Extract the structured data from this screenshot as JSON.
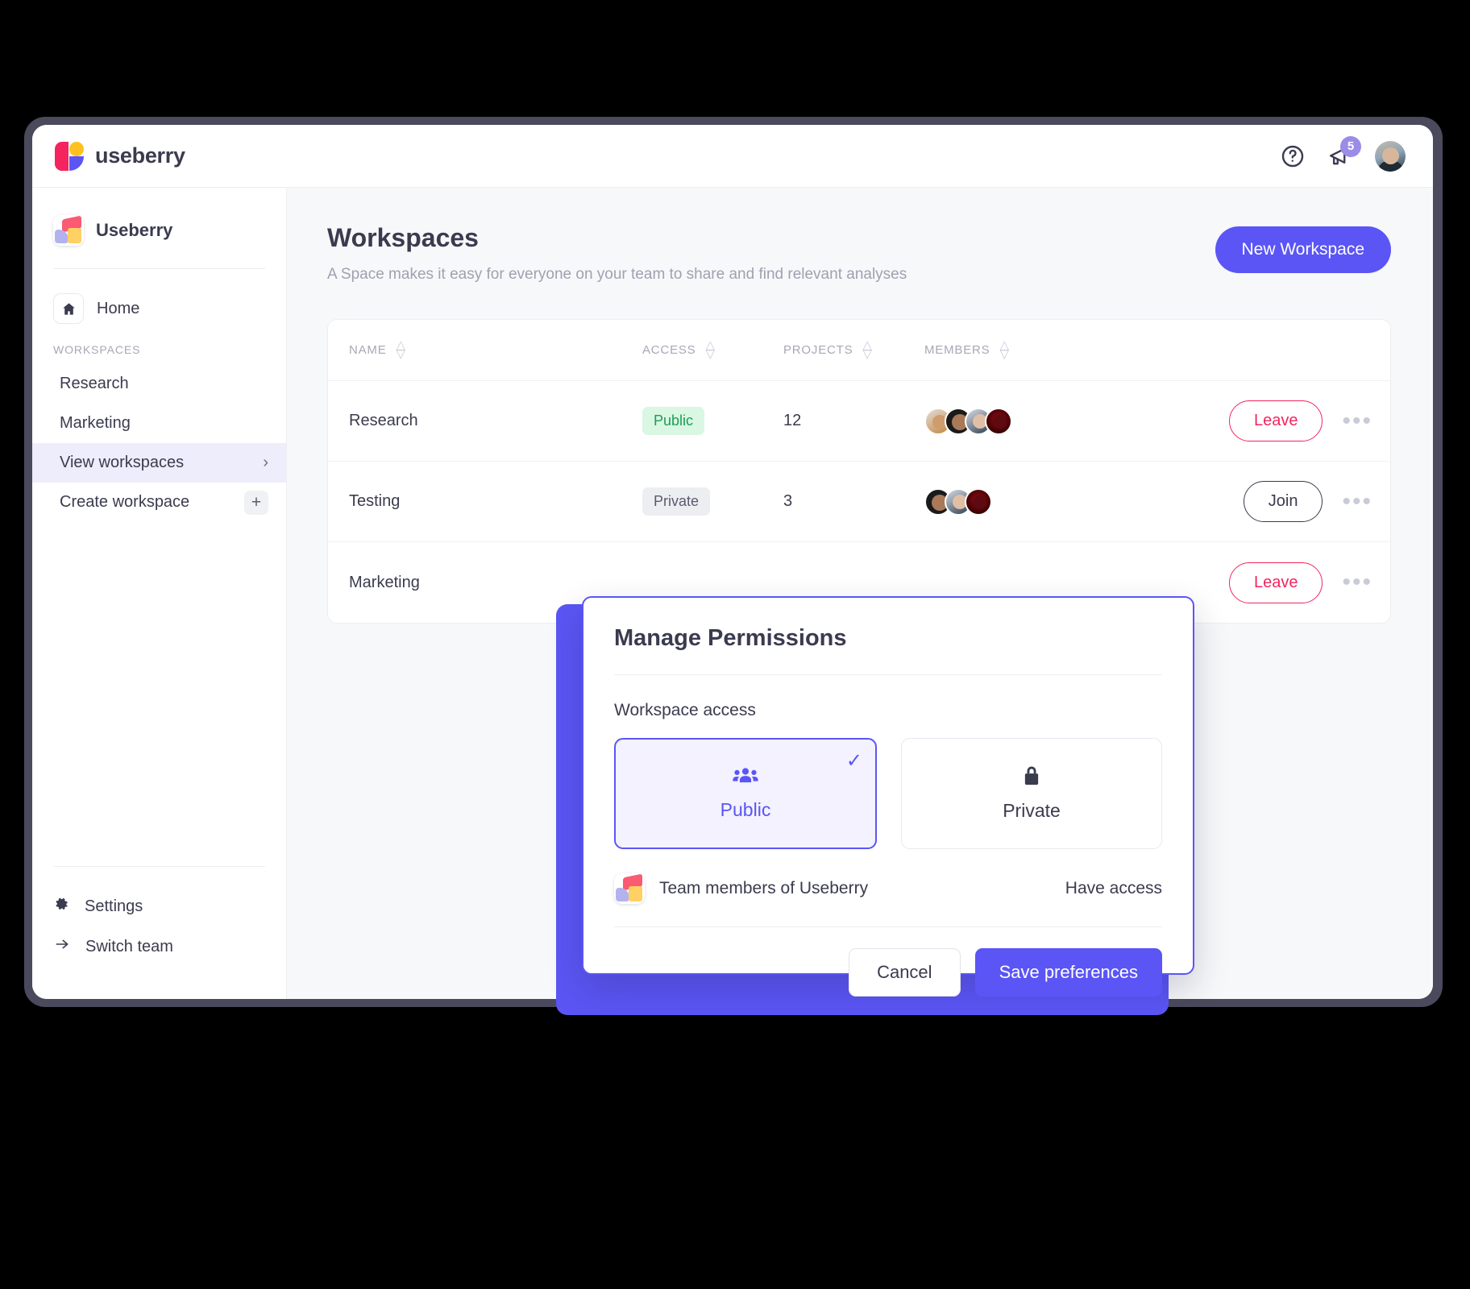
{
  "brand": {
    "name": "useberry"
  },
  "topbar": {
    "help_icon": "help-circle-icon",
    "announce_icon": "megaphone-icon",
    "announce_count": "5",
    "avatar": "user-avatar"
  },
  "sidebar": {
    "team_name": "Useberry",
    "home_label": "Home",
    "section_title": "WORKSPACES",
    "items": [
      {
        "label": "Research",
        "active": false
      },
      {
        "label": "Marketing",
        "active": false
      },
      {
        "label": "View workspaces",
        "active": true,
        "affordance": "chevron-right"
      },
      {
        "label": "Create workspace",
        "active": false,
        "affordance": "plus"
      }
    ],
    "bottom": [
      {
        "label": "Settings",
        "icon": "gear-icon"
      },
      {
        "label": "Switch team",
        "icon": "arrow-right-icon"
      }
    ]
  },
  "main": {
    "title": "Workspaces",
    "subtitle": "A Space makes it easy for everyone on your team to share and find relevant analyses",
    "new_workspace_label": "New Workspace",
    "table": {
      "columns": [
        "NAME",
        "ACCESS",
        "PROJECTS",
        "MEMBERS"
      ],
      "rows": [
        {
          "name": "Research",
          "access": "Public",
          "projects": "12",
          "members": 4,
          "action": "Leave"
        },
        {
          "name": "Testing",
          "access": "Private",
          "projects": "3",
          "members": 3,
          "action": "Join"
        },
        {
          "name": "Marketing",
          "access": "",
          "projects": "",
          "members": 0,
          "action": "Leave"
        }
      ]
    }
  },
  "modal": {
    "title": "Manage Permissions",
    "section_label": "Workspace access",
    "options": [
      {
        "label": "Public",
        "icon": "people-group-icon",
        "selected": true
      },
      {
        "label": "Private",
        "icon": "lock-icon",
        "selected": false
      }
    ],
    "team_row": {
      "name": "Team members of Useberry",
      "state": "Have access",
      "icon": "team-logo-icon"
    },
    "cancel_label": "Cancel",
    "save_label": "Save preferences"
  },
  "colors": {
    "accent": "#5b55f5",
    "danger": "#f4245e",
    "success": "#1f9e53",
    "text": "#3b3b4f",
    "muted": "#a6a8b8"
  }
}
